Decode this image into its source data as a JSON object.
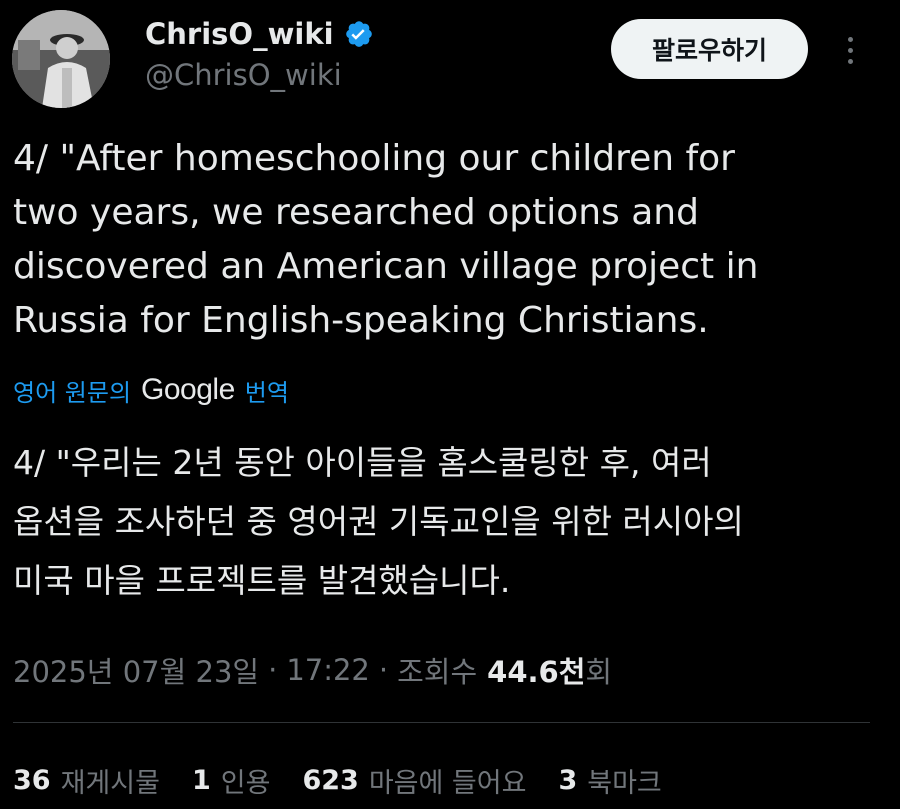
{
  "author": {
    "display_name": "ChrisO_wiki",
    "handle": "@ChrisO_wiki",
    "verified": true,
    "verified_color": "#1d9bf0"
  },
  "follow_button": {
    "label": "팔로우하기"
  },
  "more_button": {
    "icon": "more-vertical-icon"
  },
  "tweet": {
    "lines": [
      "4/ \"After homeschooling our children for",
      "two years, we researched options and",
      "discovered an American village project in",
      "Russia for English-speaking Christians."
    ]
  },
  "translation_bar": {
    "prefix": "영어 원문의",
    "brand": "Google",
    "suffix": "번역"
  },
  "translated": {
    "lines": [
      "4/ \"우리는 2년 동안 아이들을 홈스쿨링한 후, 여러",
      "옵션을 조사하던 중 영어권 기독교인을 위한 러시아의",
      "미국 마을 프로젝트를 발견했습니다."
    ]
  },
  "meta": {
    "date": "2025년 07월 23일",
    "separator": "·",
    "time": "17:22",
    "views_label": "조회수",
    "views_count": "44.6천",
    "views_suffix": "회"
  },
  "stats": {
    "reposts": {
      "count": "36",
      "label": "재게시물"
    },
    "quotes": {
      "count": "1",
      "label": "인용"
    },
    "likes": {
      "count": "623",
      "label": "마음에 들어요"
    },
    "bookmarks": {
      "count": "3",
      "label": "북마크"
    }
  },
  "colors": {
    "background": "#000000",
    "text_primary": "#e7e9ea",
    "text_secondary": "#71767b",
    "link": "#1d9bf0",
    "button_bg": "#eff3f4",
    "divider": "#2f3336"
  }
}
